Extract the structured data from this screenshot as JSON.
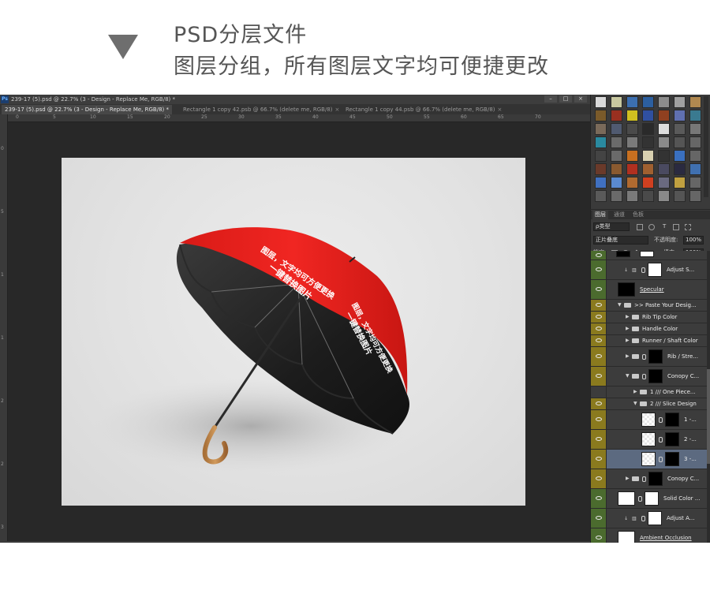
{
  "header": {
    "line1": "PSD分层文件",
    "line2": "图层分组，所有图层文字均可便捷更改"
  },
  "window": {
    "logo": "Ps",
    "title": "239-17 (5).psd @ 22.7% (3 - Design - Replace Me, RGB/8) *",
    "controls": [
      "–",
      "□",
      "×"
    ]
  },
  "tabs": [
    {
      "label": "239-17 (5).psd @ 22.7% (3 - Design - Replace Me, RGB/8) *",
      "active": true
    },
    {
      "label": "Rectangle 1 copy 42.psb @ 66.7% (delete me, RGB/8)",
      "active": false
    },
    {
      "label": "Rectangle 1 copy 44.psb @ 66.7% (delete me, RGB/8)",
      "active": false
    }
  ],
  "tab_close": "×",
  "ruler_top": [
    "0",
    "5",
    "10",
    "15",
    "20",
    "25",
    "30",
    "35",
    "40",
    "45",
    "50",
    "55",
    "60",
    "65",
    "70"
  ],
  "ruler_left": [
    "0",
    "5",
    "1",
    "1",
    "2",
    "2",
    "3"
  ],
  "umbrella_text": {
    "line1": "一键替换图片",
    "line2": "图层，文字均可方便更换"
  },
  "panel_tabs": [
    "图层",
    "通道",
    "色板"
  ],
  "layers_panel": {
    "filter_label": "ρ类型",
    "blend_mode": "正片叠底",
    "opacity_label": "不透明度:",
    "opacity_value": "100%",
    "lock_label": "锁定:",
    "fill_label": "填充:",
    "fill_value": "100%"
  },
  "layers": [
    {
      "name": "",
      "vis": "g"
    },
    {
      "name": "Adjust S...",
      "vis": "g"
    },
    {
      "name": "Specular",
      "vis": "g"
    },
    {
      "name": ">> Paste Your Desig...",
      "vis": "y"
    },
    {
      "name": "Rib Tip Color",
      "vis": "y"
    },
    {
      "name": "Handle Color",
      "vis": "y"
    },
    {
      "name": "Runner / Shaft Color",
      "vis": "y"
    },
    {
      "name": "Rib / Stre...",
      "vis": "y"
    },
    {
      "name": "Conopy C...",
      "vis": "y"
    },
    {
      "name": "1 /// One Piece...",
      "vis": "n"
    },
    {
      "name": "2 /// Slice Design",
      "vis": "y"
    },
    {
      "name": "1 -...",
      "vis": "y"
    },
    {
      "name": "2 -...",
      "vis": "y"
    },
    {
      "name": "3 -...",
      "vis": "y"
    },
    {
      "name": "Conopy C...",
      "vis": "y"
    },
    {
      "name": "Solid Color ...",
      "vis": "g"
    },
    {
      "name": "Adjust A...",
      "vis": "g"
    },
    {
      "name": "Ambient Occlusion",
      "vis": "g"
    },
    {
      "name": "Adjust S...",
      "vis": "g"
    }
  ],
  "colors": {
    "canopy_red": "#e8201c",
    "canopy_inner": "#1a1a1a",
    "handle_wood": "#c08a4e",
    "vis_yellow": "#8a7a1e",
    "vis_green": "#4b6b2e",
    "selected_row": "#5c6a80"
  }
}
